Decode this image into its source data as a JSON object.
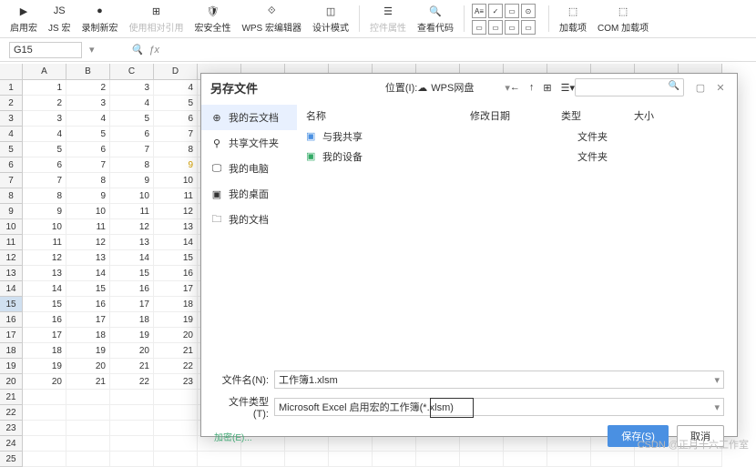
{
  "ribbon": {
    "items": [
      {
        "label": "启用宏",
        "icon": "play-doc"
      },
      {
        "label": "JS 宏",
        "icon": "js"
      },
      {
        "label": "录制新宏",
        "icon": "record"
      },
      {
        "label": "使用相对引用",
        "icon": "relative",
        "disabled": true
      },
      {
        "label": "宏安全性",
        "icon": "shield"
      },
      {
        "label": "WPS 宏编辑器",
        "icon": "editor"
      },
      {
        "label": "设计模式",
        "icon": "design"
      },
      {
        "label": "控件属性",
        "icon": "props",
        "disabled": true
      },
      {
        "label": "查看代码",
        "icon": "code"
      },
      {
        "label": "加载项",
        "icon": "addon"
      },
      {
        "label": "COM 加载项",
        "icon": "com-addon"
      }
    ]
  },
  "namebox": "G15",
  "cols": [
    "A",
    "B",
    "C",
    "D"
  ],
  "rows": [
    [
      1,
      2,
      3,
      4
    ],
    [
      2,
      3,
      4,
      5
    ],
    [
      3,
      4,
      5,
      6
    ],
    [
      4,
      5,
      6,
      7
    ],
    [
      5,
      6,
      7,
      8
    ],
    [
      6,
      7,
      8,
      9
    ],
    [
      7,
      8,
      9,
      10
    ],
    [
      8,
      9,
      10,
      11
    ],
    [
      9,
      10,
      11,
      12
    ],
    [
      10,
      11,
      12,
      13
    ],
    [
      11,
      12,
      13,
      14
    ],
    [
      12,
      13,
      14,
      15
    ],
    [
      13,
      14,
      15,
      16
    ],
    [
      14,
      15,
      16,
      17
    ],
    [
      15,
      16,
      17,
      18
    ],
    [
      16,
      17,
      18,
      19
    ],
    [
      17,
      18,
      19,
      20
    ],
    [
      18,
      19,
      20,
      21
    ],
    [
      19,
      20,
      21,
      22
    ],
    [
      20,
      21,
      22,
      23
    ]
  ],
  "selected_row": 15,
  "dialog": {
    "title": "另存文件",
    "location_label": "位置(I):",
    "location_value": "WPS网盘",
    "sidebar": [
      {
        "label": "我的云文档",
        "active": true
      },
      {
        "label": "共享文件夹"
      },
      {
        "label": "我的电脑"
      },
      {
        "label": "我的桌面"
      },
      {
        "label": "我的文档"
      }
    ],
    "headers": {
      "name": "名称",
      "date": "修改日期",
      "type": "类型",
      "size": "大小"
    },
    "files": [
      {
        "name": "与我共享",
        "type": "文件夹",
        "color": "#4a90e2"
      },
      {
        "name": "我的设备",
        "type": "文件夹",
        "color": "#3a6"
      }
    ],
    "filename_label": "文件名(N):",
    "filename_value": "工作簿1.xlsm",
    "filetype_label": "文件类型(T):",
    "filetype_value": "Microsoft Excel 启用宏的工作簿(*.xlsm)",
    "encrypt": "加密(E)...",
    "save": "保存(S)",
    "cancel": "取消"
  },
  "watermark": "CSDN @正月十六工作室"
}
